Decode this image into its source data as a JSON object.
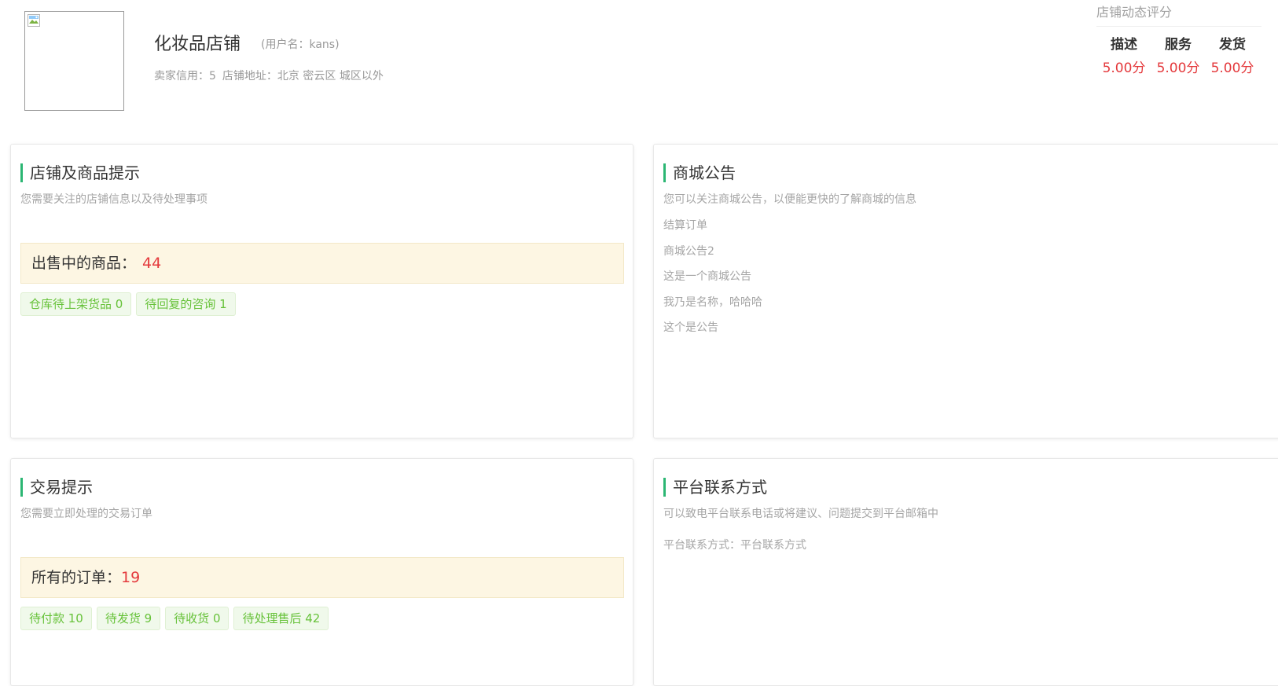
{
  "shop": {
    "name": "化妆品店铺",
    "username": "(用户名：kans)",
    "credit": "卖家信用：5",
    "address": "店铺地址：北京 密云区 城区以外"
  },
  "rating": {
    "title": "店铺动态评分",
    "items": [
      {
        "label": "描述",
        "value": "5.00分"
      },
      {
        "label": "服务",
        "value": "5.00分"
      },
      {
        "label": "发货",
        "value": "5.00分"
      }
    ]
  },
  "store_tips": {
    "title": "店铺及商品提示",
    "subtitle": "您需要关注的店铺信息以及待处理事项",
    "on_sale_label": "出售中的商品：",
    "on_sale_count": "44",
    "tags": [
      "仓库待上架货品 0",
      "待回复的咨询 1"
    ]
  },
  "announcements": {
    "title": "商城公告",
    "subtitle": "您可以关注商城公告，以便能更快的了解商城的信息",
    "items": [
      "结算订单",
      "商城公告2",
      "这是一个商城公告",
      "我乃是名称，哈哈哈",
      "这个是公告"
    ]
  },
  "trade_tips": {
    "title": "交易提示",
    "subtitle": "您需要立即处理的交易订单",
    "all_orders_label": "所有的订单：",
    "all_orders_count": "19",
    "tags": [
      "待付款 10",
      "待发货 9",
      "待收货 0",
      "待处理售后 42"
    ]
  },
  "contact": {
    "title": "平台联系方式",
    "subtitle": "可以致电平台联系电话或将建议、问题提交到平台邮箱中",
    "text": "平台联系方式：平台联系方式"
  },
  "colors": {
    "accent": "#2bb673",
    "number_red": "#e4393c",
    "tag_green": "#67c23a",
    "highlight_bg": "#fdf6e3"
  },
  "icons": {
    "shop_logo": "broken-image-icon"
  }
}
